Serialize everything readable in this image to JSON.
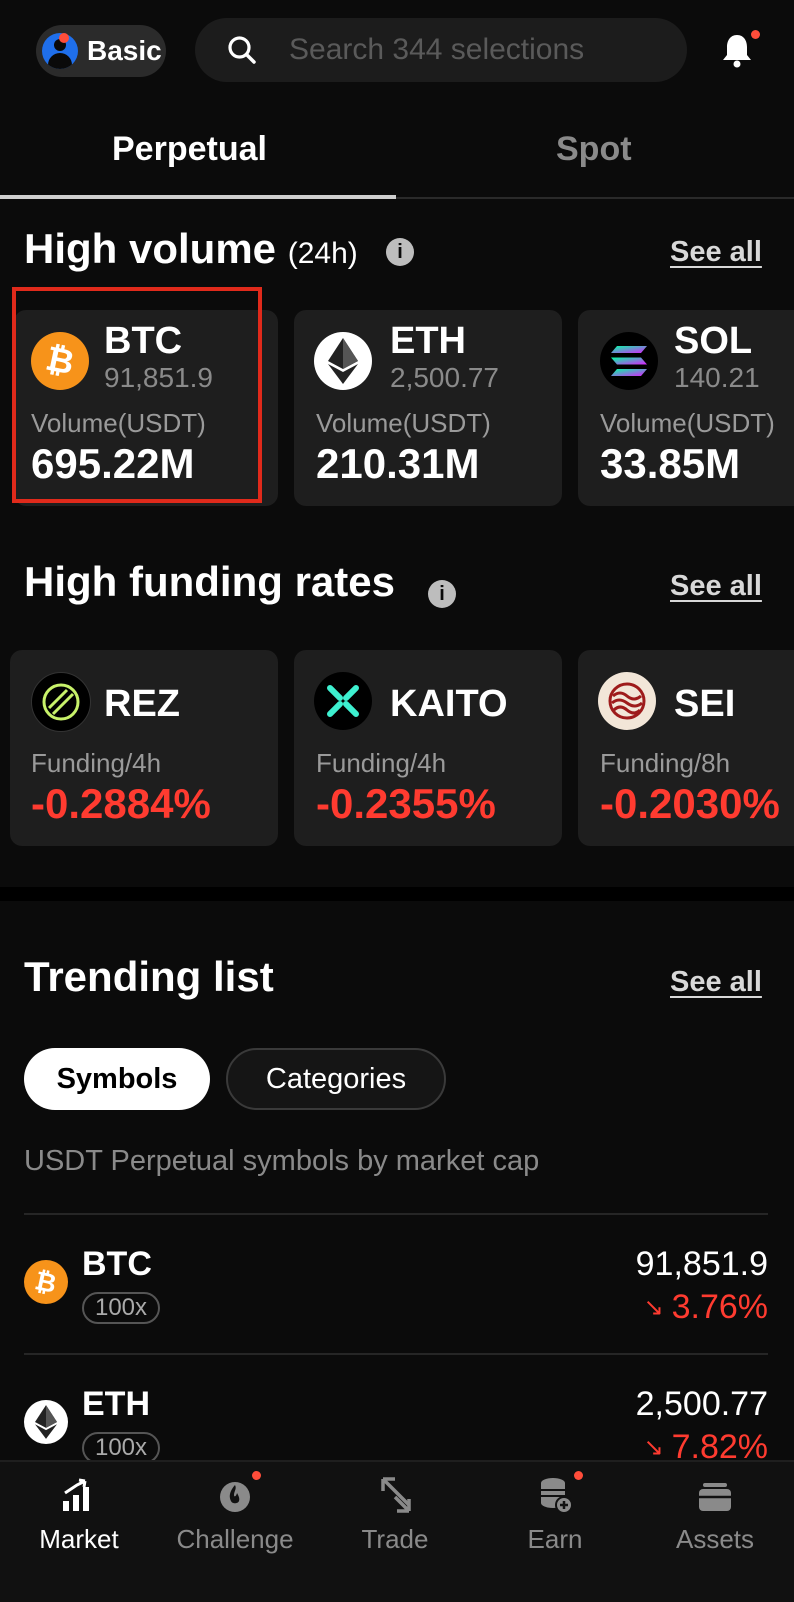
{
  "header": {
    "account_label": "Basic",
    "search_placeholder": "Search 344 selections"
  },
  "tabs": [
    {
      "label": "Perpetual",
      "active": true
    },
    {
      "label": "Spot",
      "active": false
    }
  ],
  "high_volume": {
    "title": "High volume",
    "subtitle": "(24h)",
    "see_all": "See all",
    "cards": [
      {
        "symbol": "BTC",
        "price": "91,851.9",
        "metric_label": "Volume(USDT)",
        "metric_value": "695.22M",
        "icon": "bitcoin-icon"
      },
      {
        "symbol": "ETH",
        "price": "2,500.77",
        "metric_label": "Volume(USDT)",
        "metric_value": "210.31M",
        "icon": "ethereum-icon"
      },
      {
        "symbol": "SOL",
        "price": "140.21",
        "metric_label": "Volume(USDT)",
        "metric_value": "33.85M",
        "icon": "solana-icon"
      }
    ]
  },
  "high_funding": {
    "title": "High funding rates",
    "see_all": "See all",
    "cards": [
      {
        "symbol": "REZ",
        "metric_label": "Funding/4h",
        "metric_value": "-0.2884%",
        "icon": "rez-icon"
      },
      {
        "symbol": "KAITO",
        "metric_label": "Funding/4h",
        "metric_value": "-0.2355%",
        "icon": "kaito-icon"
      },
      {
        "symbol": "SEI",
        "metric_label": "Funding/8h",
        "metric_value": "-0.2030%",
        "icon": "sei-icon"
      }
    ]
  },
  "trending": {
    "title": "Trending list",
    "see_all": "See all",
    "chips": [
      {
        "label": "Symbols",
        "active": true
      },
      {
        "label": "Categories",
        "active": false
      }
    ],
    "description": "USDT Perpetual symbols by market cap",
    "rows": [
      {
        "symbol": "BTC",
        "leverage": "100x",
        "price": "91,851.9",
        "change": "3.76%",
        "icon": "bitcoin-icon",
        "direction": "down"
      },
      {
        "symbol": "ETH",
        "leverage": "100x",
        "price": "2,500.77",
        "change": "7.82%",
        "icon": "ethereum-icon",
        "direction": "down"
      }
    ]
  },
  "bottom_nav": [
    {
      "label": "Market",
      "icon": "market-chart-icon",
      "active": true
    },
    {
      "label": "Challenge",
      "icon": "flame-icon",
      "active": false
    },
    {
      "label": "Trade",
      "icon": "trade-arrows-icon",
      "active": false
    },
    {
      "label": "Earn",
      "icon": "coins-stack-icon",
      "active": false
    },
    {
      "label": "Assets",
      "icon": "wallet-icon",
      "active": false
    }
  ],
  "colors": {
    "negative": "#ff3b30",
    "highlight": "#e02a1b",
    "notification_dot": "#ff4d3a",
    "btc": "#f7931a"
  }
}
